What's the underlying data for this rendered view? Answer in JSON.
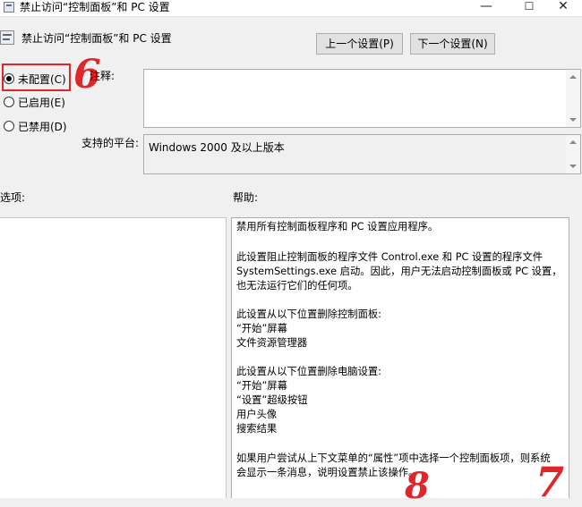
{
  "window": {
    "title": "禁止访问“控制面板”和 PC 设置",
    "min_glyph": "—",
    "max_glyph": "☐",
    "close_glyph": "✕"
  },
  "header": {
    "policy_title": "禁止访问“控制面板”和 PC 设置",
    "prev_button": "上一个设置(P)",
    "next_button": "下一个设置(N)"
  },
  "state_options": [
    {
      "label": "未配置(C)",
      "checked": true
    },
    {
      "label": "已启用(E)",
      "checked": false
    },
    {
      "label": "已禁用(D)",
      "checked": false
    }
  ],
  "comment": {
    "label": "注释:",
    "value": ""
  },
  "supported_on": {
    "label": "支持的平台:",
    "value": "Windows 2000 及以上版本"
  },
  "options_label": "选项:",
  "help": {
    "label": "帮助:",
    "lines": [
      "禁用所有控制面板程序和 PC 设置应用程序。",
      "",
      "此设置阻止控制面板的程序文件 Control.exe 和 PC 设置的程序文件",
      "SystemSettings.exe 启动。因此，用户无法启动控制面板或 PC 设置，",
      "也无法运行它们的任何项。",
      "",
      "此设置从以下位置删除控制面板:",
      "“开始”屏幕",
      "文件资源管理器",
      "",
      "此设置从以下位置删除电脑设置:",
      "“开始”屏幕",
      "“设置”超级按钮",
      "用户头像",
      "搜索结果",
      "",
      "如果用户尝试从上下文菜单的“属性”项中选择一个控制面板项，则系统",
      "会显示一条消息，说明设置禁止该操作。"
    ]
  },
  "annotations": {
    "highlight_color": "#e0262b",
    "step6": "6",
    "step8": "8",
    "step7": "7"
  }
}
